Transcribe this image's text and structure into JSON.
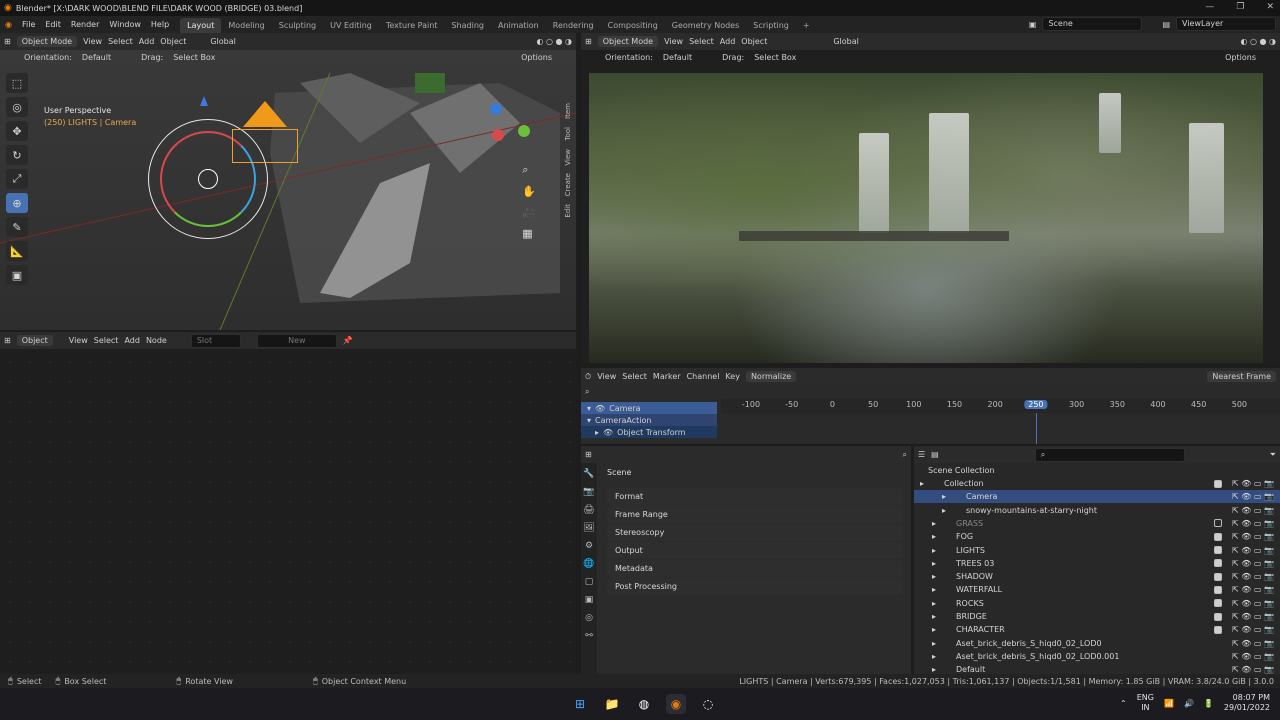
{
  "titlebar": {
    "title": "Blender* [X:\\DARK WOOD\\BLEND FILE\\DARK WOOD (BRIDGE) 03.blend]",
    "minimize": "—",
    "maximize": "❐",
    "close": "✕"
  },
  "menubar": {
    "items": [
      "File",
      "Edit",
      "Render",
      "Window",
      "Help"
    ],
    "workspaces": [
      "Layout",
      "Modeling",
      "Sculpting",
      "UV Editing",
      "Texture Paint",
      "Shading",
      "Animation",
      "Rendering",
      "Compositing",
      "Geometry Nodes",
      "Scripting"
    ],
    "add_ws": "+",
    "scene": "Scene",
    "view_layer": "ViewLayer"
  },
  "viewport": {
    "mode": "Object Mode",
    "menus": [
      "View",
      "Select",
      "Add",
      "Object"
    ],
    "transform": "Global",
    "orientation_label": "Orientation:",
    "orientation_value": "Default",
    "drag_label": "Drag:",
    "drag_value": "Select Box",
    "options": "Options",
    "perspective": "User Perspective",
    "collection_info": "(250) LIGHTS | Camera",
    "side_tabs": [
      "Item",
      "Tool",
      "View",
      "Create",
      "Edit"
    ]
  },
  "camera_view": {
    "mode": "Object Mode",
    "menus": [
      "View",
      "Select",
      "Add",
      "Object"
    ],
    "transform": "Global",
    "orientation_label": "Orientation:",
    "orientation_value": "Default",
    "drag_label": "Drag:",
    "drag_value": "Select Box",
    "options": "Options"
  },
  "node_editor": {
    "type": "Object",
    "menus": [
      "View",
      "Select",
      "Add",
      "Node"
    ],
    "slot": "Slot",
    "new": "New"
  },
  "dopesheet": {
    "menus": [
      "View",
      "Select",
      "Marker",
      "Channel",
      "Key"
    ],
    "normalize": "Normalize",
    "snap": "Nearest Frame",
    "ticks": [
      "-100",
      "-50",
      "0",
      "50",
      "100",
      "150",
      "200",
      "250",
      "300",
      "350",
      "400",
      "450",
      "500"
    ],
    "current_frame": "250",
    "channels": [
      "Camera",
      "CameraAction",
      "Object Transform"
    ]
  },
  "properties": {
    "scene": "Scene",
    "panels": [
      "Format",
      "Frame Range",
      "Stereoscopy",
      "Output",
      "Metadata",
      "Post Processing"
    ]
  },
  "outliner": {
    "root": "Scene Collection",
    "rows": [
      {
        "name": "Collection",
        "checked": true
      },
      {
        "name": "Camera",
        "checked": null
      },
      {
        "name": "snowy-mountains-at-starry-night",
        "checked": null
      },
      {
        "name": "GRASS",
        "checked": false
      },
      {
        "name": "FOG",
        "checked": true
      },
      {
        "name": "LIGHTS",
        "checked": true
      },
      {
        "name": "TREES 03",
        "checked": true
      },
      {
        "name": "SHADOW",
        "checked": true
      },
      {
        "name": "WATERFALL",
        "checked": true
      },
      {
        "name": "ROCKS",
        "checked": true
      },
      {
        "name": "BRIDGE",
        "checked": true
      },
      {
        "name": "CHARACTER",
        "checked": true
      },
      {
        "name": "Aset_brick_debris_S_hiqd0_02_LOD0",
        "checked": null
      },
      {
        "name": "Aset_brick_debris_S_hiqd0_02_LOD0.001",
        "checked": null
      },
      {
        "name": "Default",
        "checked": null
      }
    ]
  },
  "statusbar": {
    "select": "Select",
    "box_select": "Box Select",
    "rotate_view": "Rotate View",
    "context_menu": "Object Context Menu",
    "stats": "LIGHTS | Camera | Verts:679,395 | Faces:1,027,053 | Tris:1,061,137 | Objects:1/1,581 | Memory: 1.85 GiB | VRAM: 3.8/24.0 GiB | 3.0.0"
  },
  "taskbar": {
    "lang": "ENG",
    "region": "IN",
    "time": "08:07 PM",
    "date": "29/01/2022"
  },
  "colors": {
    "accent": "#4772b3",
    "orange": "#e87d0d",
    "selected_row": "#334d80"
  }
}
